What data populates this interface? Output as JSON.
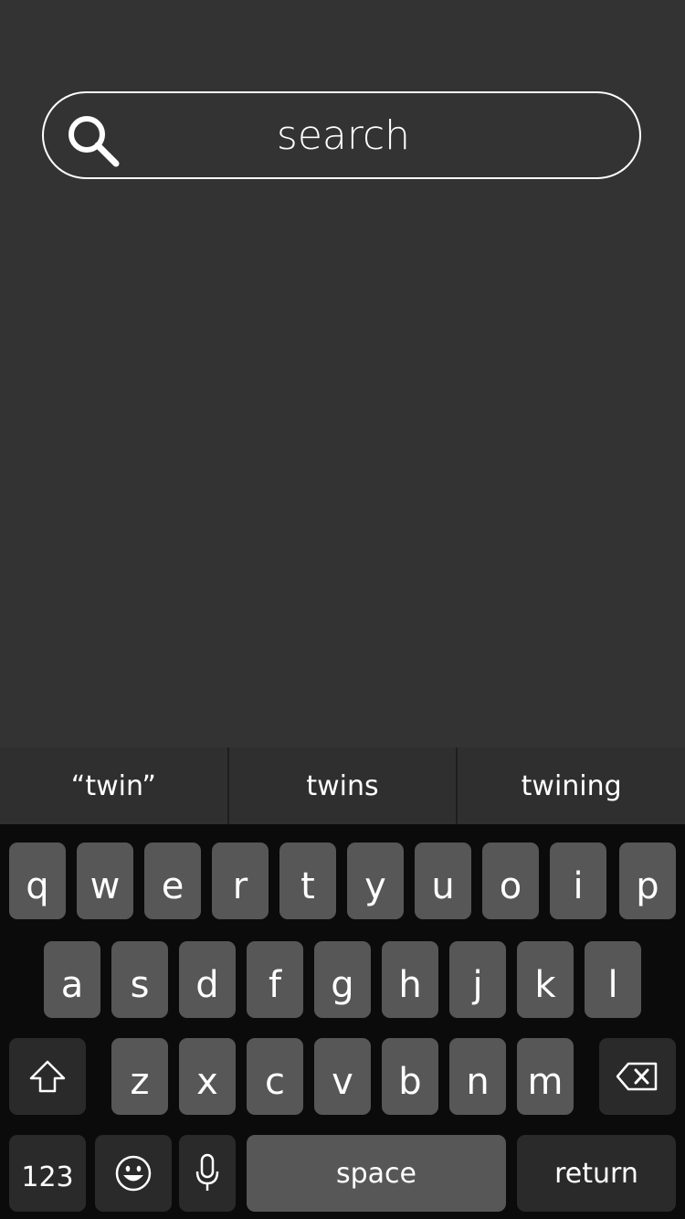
{
  "search": {
    "placeholder": "search",
    "icon": "search-icon"
  },
  "suggestions": [
    "“twin”",
    "twins",
    "twining"
  ],
  "keyboard": {
    "row1": [
      "q",
      "w",
      "e",
      "r",
      "t",
      "y",
      "u",
      "o",
      "i",
      "p"
    ],
    "row2": [
      "a",
      "s",
      "d",
      "f",
      "g",
      "h",
      "j",
      "k",
      "l"
    ],
    "row3": [
      "z",
      "x",
      "c",
      "v",
      "b",
      "n",
      "m"
    ],
    "shift_icon": "shift-icon",
    "delete_icon": "backspace-icon",
    "numbers_label": "123",
    "emoji_icon": "emoji-icon",
    "mic_icon": "microphone-icon",
    "space_label": "space",
    "return_label": "return"
  },
  "colors": {
    "background": "#333333",
    "keyboard_background": "#0b0b0b",
    "key": "#575757",
    "function_key": "#2a2a2a",
    "text": "#ffffff"
  }
}
